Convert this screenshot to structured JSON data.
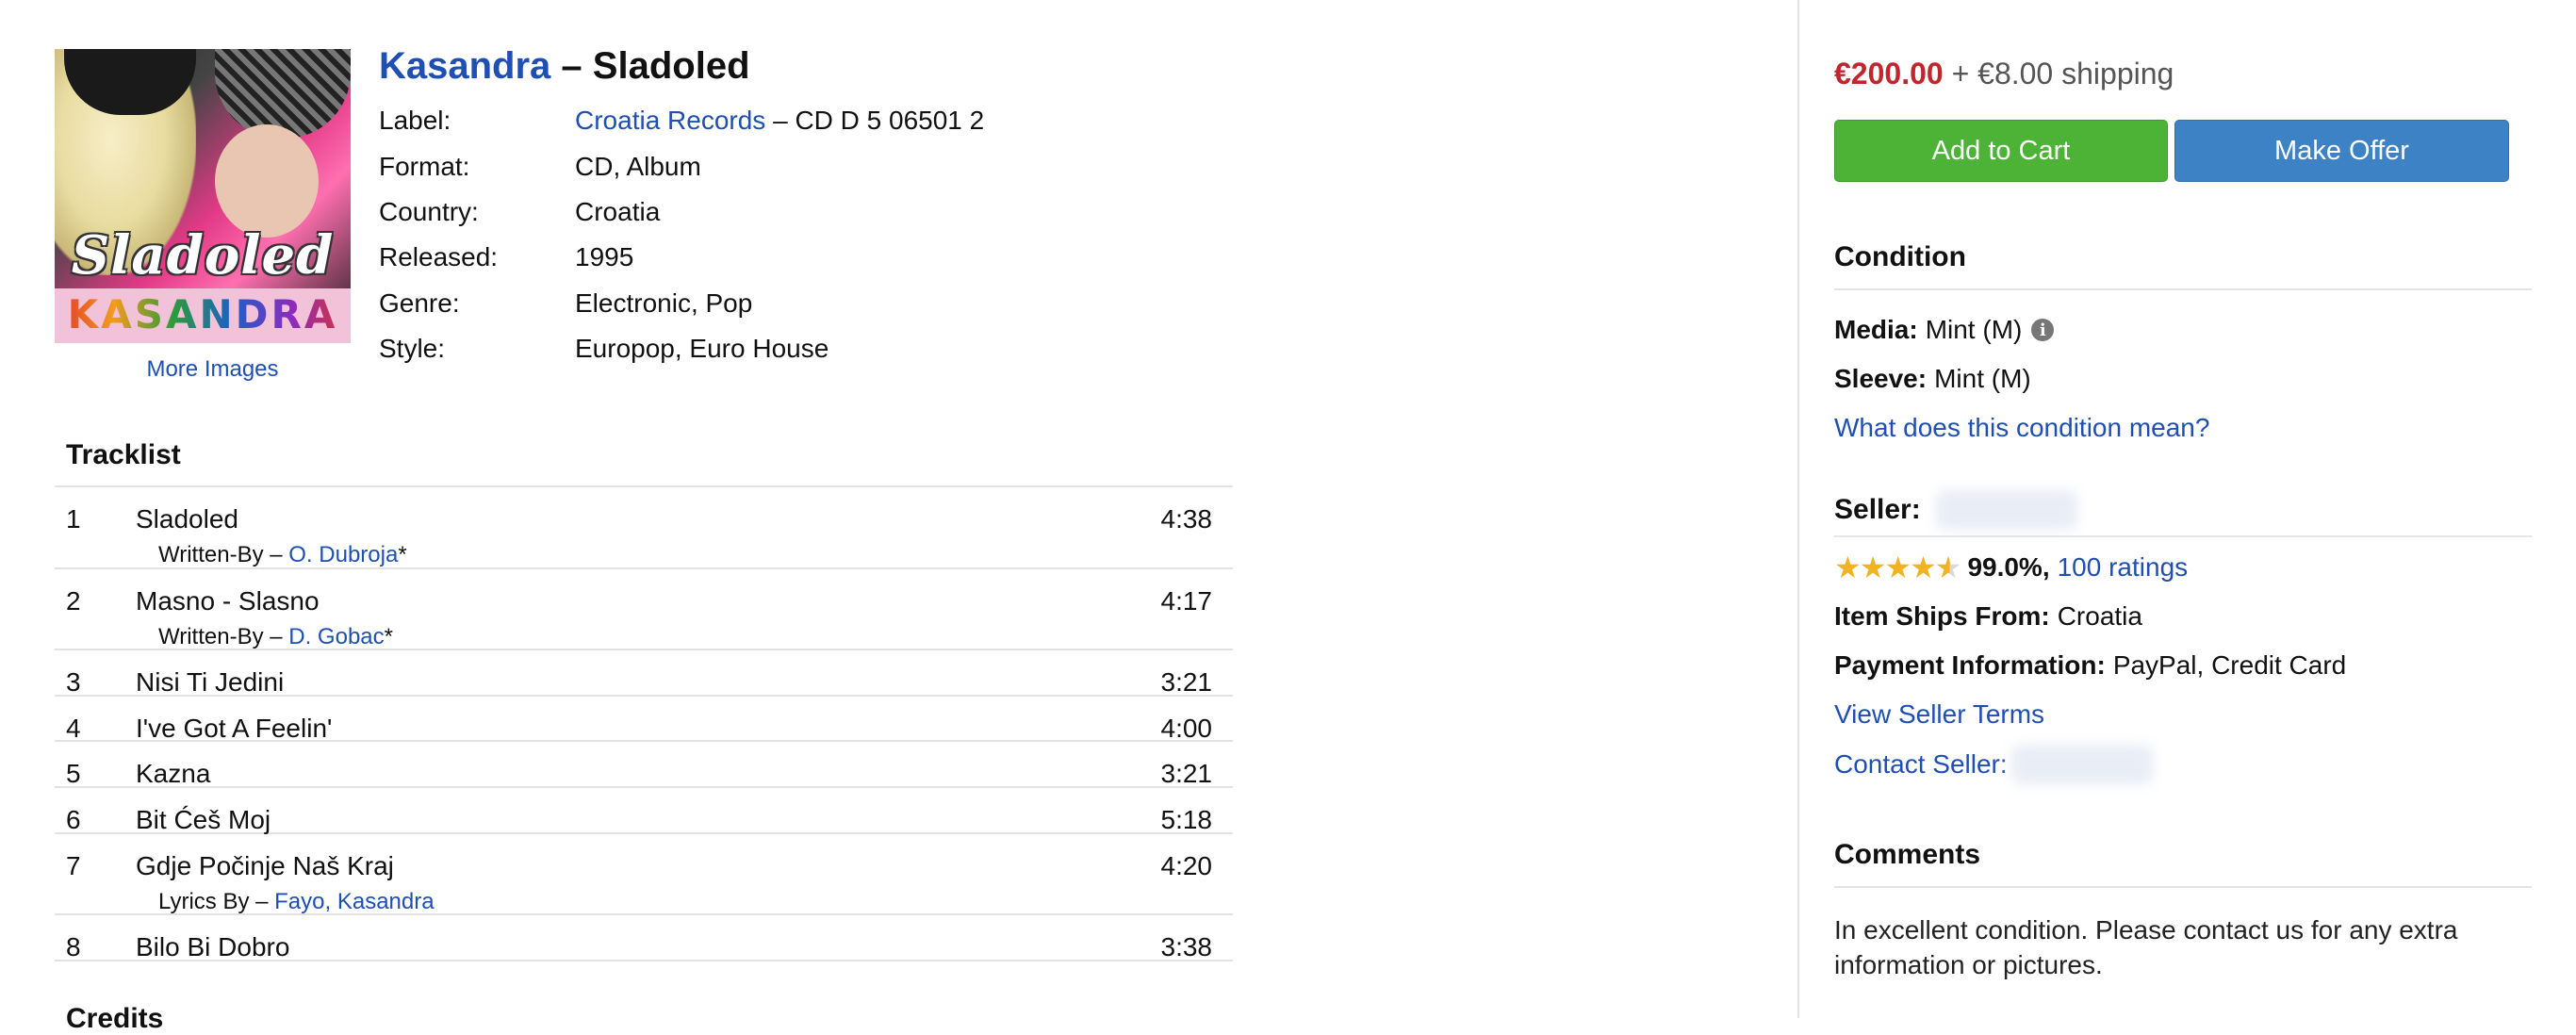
{
  "release": {
    "artist": "Kasandra",
    "separator": " – ",
    "title": "Sladoled",
    "cover": {
      "script_text": "Sladoled",
      "band_text": "KASANDRA"
    },
    "more_images": "More Images",
    "details": [
      {
        "key": "Label:",
        "value_link": "Croatia Records",
        "value_rest": " – CD D 5 06501 2"
      },
      {
        "key": "Format:",
        "value": "CD, Album"
      },
      {
        "key": "Country:",
        "value": "Croatia"
      },
      {
        "key": "Released:",
        "value": "1995"
      },
      {
        "key": "Genre:",
        "value": "Electronic, Pop"
      },
      {
        "key": "Style:",
        "value": "Europop, Euro House"
      }
    ]
  },
  "tracklist": {
    "heading": "Tracklist",
    "tracks": [
      {
        "pos": "1",
        "title": "Sladoled",
        "duration": "4:38",
        "credit_role": "Written-By – ",
        "credit_name": "O. Dubroja",
        "credit_suffix": "*"
      },
      {
        "pos": "2",
        "title": "Masno - Slasno",
        "duration": "4:17",
        "credit_role": "Written-By – ",
        "credit_name": "D. Gobac",
        "credit_suffix": "*"
      },
      {
        "pos": "3",
        "title": "Nisi Ti Jedini",
        "duration": "3:21"
      },
      {
        "pos": "4",
        "title": "I've Got A Feelin'",
        "duration": "4:00"
      },
      {
        "pos": "5",
        "title": "Kazna",
        "duration": "3:21"
      },
      {
        "pos": "6",
        "title": "Bit Ćeš Moj",
        "duration": "5:18"
      },
      {
        "pos": "7",
        "title": "Gdje Počinje Naš Kraj",
        "duration": "4:20",
        "credit_role": "Lyrics By – ",
        "credit_name": "Fayo, Kasandra",
        "credit_suffix": ""
      },
      {
        "pos": "8",
        "title": "Bilo Bi Dobro",
        "duration": "3:38"
      }
    ]
  },
  "credits_heading": "Credits",
  "sidebar": {
    "price": "€200.00",
    "shipping": " + €8.00 shipping",
    "add_to_cart": "Add to Cart",
    "make_offer": "Make Offer",
    "condition": {
      "heading": "Condition",
      "media_label": "Media:",
      "media_value": "Mint (M)",
      "info_icon": "info-icon",
      "sleeve_label": "Sleeve:",
      "sleeve_value": "Mint (M)",
      "help_link": "What does this condition mean?"
    },
    "seller": {
      "heading": "Seller:",
      "rating_stars": 4.5,
      "rating_percent": "99.0%,",
      "ratings_link": "100 ratings",
      "ships_from_label": "Item Ships From:",
      "ships_from_value": "Croatia",
      "payment_label": "Payment Information:",
      "payment_value": "PayPal, Credit Card",
      "terms_link": "View Seller Terms",
      "contact_link": "Contact Seller:"
    },
    "comments": {
      "heading": "Comments",
      "text": "In excellent condition. Please contact us for any extra information or pictures."
    }
  },
  "colors": {
    "link": "#1f4fb3",
    "price": "#c0262c",
    "add_to_cart_bg": "#4db337",
    "make_offer_bg": "#3d82c4",
    "star": "#f2b320"
  }
}
